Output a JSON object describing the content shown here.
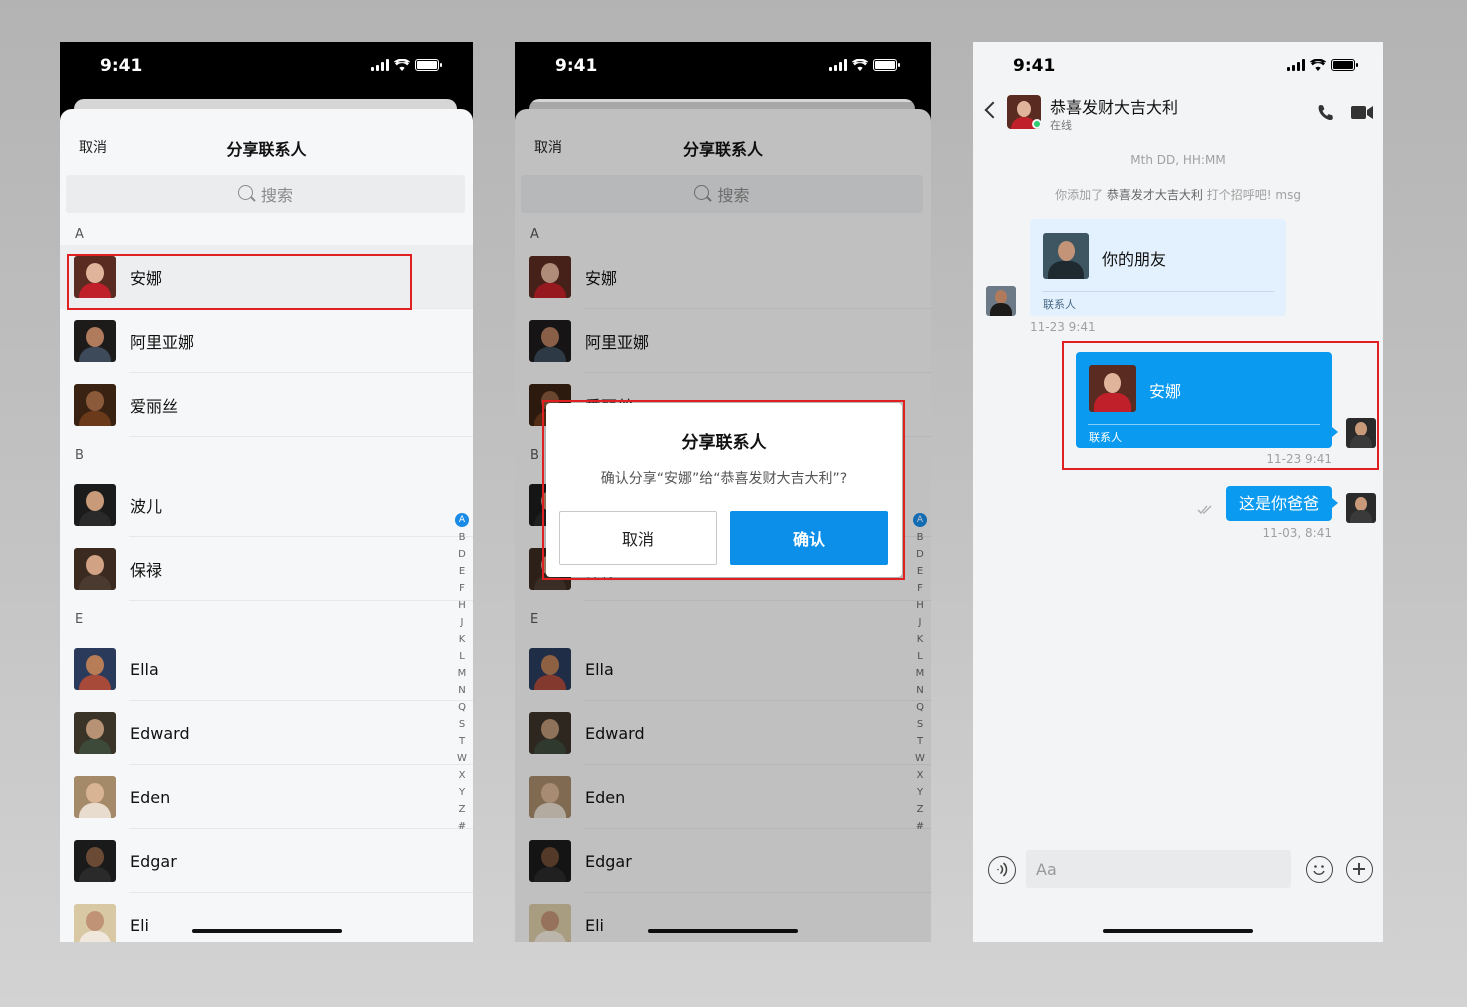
{
  "status": {
    "time": "9:41"
  },
  "share_sheet": {
    "cancel_label": "取消",
    "title": "分享联系人",
    "search_placeholder": "搜索",
    "sections": [
      {
        "letter": "A",
        "contacts": [
          {
            "name": "安娜",
            "colors": [
              "#5a2b20",
              "#e0b49b",
              "#c0202a"
            ]
          },
          {
            "name": "阿里亚娜",
            "colors": [
              "#1d1a1a",
              "#b07a5c",
              "#3c4a5a"
            ]
          },
          {
            "name": "爱丽丝",
            "colors": [
              "#3a2212",
              "#8a5a3b",
              "#6b3a1b"
            ]
          }
        ]
      },
      {
        "letter": "B",
        "contacts": [
          {
            "name": "波儿",
            "colors": [
              "#1b1b1b",
              "#c89a7a",
              "#2a2a2a"
            ]
          },
          {
            "name": "保禄",
            "colors": [
              "#3a2a20",
              "#d1a284",
              "#4a3a30"
            ]
          }
        ]
      },
      {
        "letter": "E",
        "contacts": [
          {
            "name": "Ella",
            "colors": [
              "#2a3a5a",
              "#b77d56",
              "#a84a3a"
            ]
          },
          {
            "name": "Edward",
            "colors": [
              "#3a3328",
              "#b89274",
              "#3d4a3a"
            ]
          },
          {
            "name": "Eden",
            "colors": [
              "#a58a6a",
              "#d8b394",
              "#e7dccd"
            ]
          },
          {
            "name": "Edgar",
            "colors": [
              "#1a1a1a",
              "#6a4a34",
              "#2a2a2a"
            ]
          },
          {
            "name": "Eli",
            "colors": [
              "#d8c9a4",
              "#c09276",
              "#f0e8dc"
            ]
          }
        ]
      }
    ],
    "index_letters": [
      "A",
      "B",
      "D",
      "E",
      "F",
      "H",
      "J",
      "K",
      "L",
      "M",
      "N",
      "Q",
      "S",
      "T",
      "W",
      "X",
      "Y",
      "Z",
      "#"
    ]
  },
  "dialog": {
    "title": "分享联系人",
    "message": "确认分享“安娜”给“恭喜发财大吉大利”?",
    "cancel_label": "取消",
    "confirm_label": "确认"
  },
  "chat": {
    "contact_name": "恭喜发财大吉大利",
    "contact_status": "在线",
    "system_time": "Mth DD, HH:MM",
    "system_msg_prefix": "你添加了",
    "system_msg_name": "恭喜发才大吉大利",
    "system_msg_suffix": "打个招呼吧!  msg",
    "incoming_card": {
      "name": "你的朋友",
      "label": "联系人",
      "time": "11-23 9:41"
    },
    "outgoing_card": {
      "name": "安娜",
      "label": "联系人",
      "time": "11-23 9:41"
    },
    "outgoing_text": {
      "text": "这是你爸爸",
      "time": "11-03, 8:41"
    },
    "input_placeholder": "Aa"
  },
  "colors": {
    "accent": "#0a9bf0",
    "highlight": "#e02020",
    "online": "#2ecc71"
  }
}
